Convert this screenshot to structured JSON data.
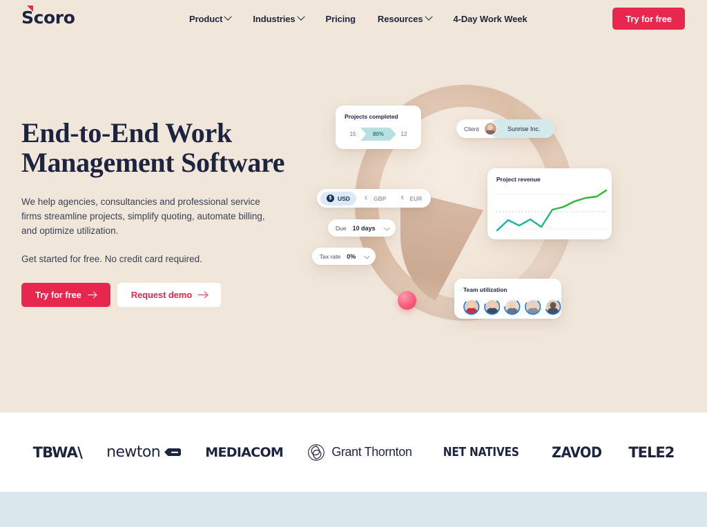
{
  "brand": {
    "logo_text": "Scoro",
    "accent_color": "#e8274f",
    "ink_color": "#1d2440",
    "hero_bg": "#f0e6da",
    "bottom_band_color": "#dae7eb"
  },
  "nav": {
    "items": [
      {
        "label": "Product",
        "has_dropdown": true
      },
      {
        "label": "Industries",
        "has_dropdown": true
      },
      {
        "label": "Pricing",
        "has_dropdown": false
      },
      {
        "label": "Resources",
        "has_dropdown": true
      },
      {
        "label": "4-Day Work Week",
        "has_dropdown": false
      }
    ],
    "cta_label": "Try for free"
  },
  "hero": {
    "title_line1": "End-to-End Work",
    "title_line2": "Management Software",
    "paragraph": "We help agencies, consultancies and professional service firms streamline projects, simplify quoting, automate billing, and optimize utilization.",
    "subtext": "Get started for free. No credit card required.",
    "primary_cta": "Try for free",
    "secondary_cta": "Request demo"
  },
  "illustration": {
    "projects_card": {
      "label": "Projects completed",
      "left_value": "15",
      "badge_value": "80%",
      "right_value": "12",
      "badge_color": "#b8e0e0"
    },
    "client_card": {
      "label": "Client",
      "value": "Sunrise Inc.",
      "pill_color": "#d4e9ec"
    },
    "currency_card": {
      "options": [
        {
          "symbol": "$",
          "code": "USD",
          "active": true
        },
        {
          "symbol": "£",
          "code": "GBP",
          "active": false
        },
        {
          "symbol": "€",
          "code": "EUR",
          "active": false
        }
      ]
    },
    "due_card": {
      "label": "Due",
      "value": "10 days"
    },
    "tax_card": {
      "label": "Tax rate",
      "value": "0%"
    },
    "revenue_card": {
      "title": "Project revenue",
      "line_color_start": "#16b0a8",
      "line_color_end": "#2eb534"
    },
    "team_card": {
      "title": "Team utilization",
      "member_count": 5,
      "ring_color": "#1a73e8"
    }
  },
  "chart_data": {
    "type": "line",
    "title": "Project revenue",
    "x": [
      0,
      1,
      2,
      3,
      4,
      5,
      6,
      7,
      8,
      9,
      10
    ],
    "values": [
      8,
      30,
      18,
      32,
      16,
      52,
      58,
      68,
      74,
      76,
      92
    ],
    "xlabel": "",
    "ylabel": "",
    "ylim": [
      0,
      100
    ],
    "grid": true,
    "annotations": [
      "dashed reference line at y=50"
    ],
    "series": [
      {
        "name": "Project revenue",
        "color": "#2eb534",
        "values": [
          8,
          30,
          18,
          32,
          16,
          52,
          58,
          68,
          74,
          76,
          92
        ]
      }
    ]
  },
  "client_logos": [
    {
      "name": "TBWA\\",
      "key": "tbwa"
    },
    {
      "name": "newton",
      "key": "newton"
    },
    {
      "name": "MEDIACOM",
      "key": "mediacom"
    },
    {
      "name": "Grant Thornton",
      "key": "grant-thornton"
    },
    {
      "name": "NET NATIVES",
      "key": "net-natives"
    },
    {
      "name": "ZAVOD",
      "key": "zavod"
    },
    {
      "name": "TELE2",
      "key": "tele2"
    }
  ]
}
